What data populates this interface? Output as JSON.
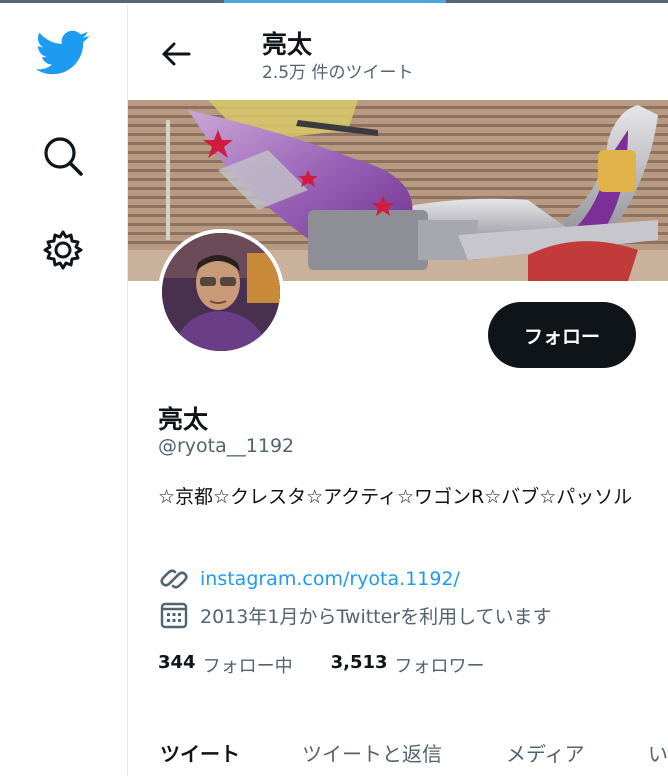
{
  "header": {
    "title": "亮太",
    "tweet_count": "2.5万 件のツイート"
  },
  "profile": {
    "follow_label": "フォロー",
    "name": "亮太",
    "handle": "@ryota__1192",
    "bio": "☆京都☆クレスタ☆アクティ☆ワゴンR☆バブ☆パッソル",
    "link": "instagram.com/ryota.1192/",
    "joined": "2013年1月からTwitterを利用しています",
    "following_count": "344",
    "following_label": "フォロー中",
    "followers_count": "3,513",
    "followers_label": "フォロワー"
  },
  "tabs": [
    {
      "label": "ツイート"
    },
    {
      "label": "ツイートと返信"
    },
    {
      "label": "メディア"
    },
    {
      "label": "い"
    }
  ],
  "colors": {
    "brand": "#1d9bf0",
    "text": "#0f1419",
    "secondary": "#536471",
    "button": "#0f1419"
  },
  "icons": [
    "twitter-bird-icon",
    "search-icon",
    "gear-icon",
    "back-arrow-icon",
    "link-icon",
    "calendar-icon"
  ]
}
